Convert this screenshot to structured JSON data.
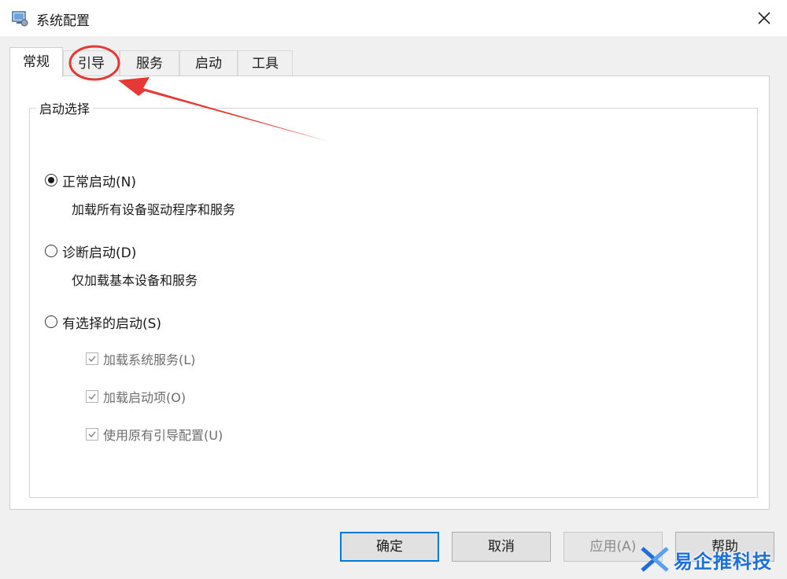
{
  "window": {
    "title": "系统配置",
    "icon": "msconfig-icon",
    "close_icon": "close-icon"
  },
  "tabs": [
    {
      "label": "常规",
      "active": true
    },
    {
      "label": "引导",
      "active": false
    },
    {
      "label": "服务",
      "active": false
    },
    {
      "label": "启动",
      "active": false
    },
    {
      "label": "工具",
      "active": false
    }
  ],
  "startup_selection": {
    "group_label": "启动选择",
    "options": [
      {
        "label": "正常启动(N)",
        "description": "加载所有设备驱动程序和服务",
        "selected": true
      },
      {
        "label": "诊断启动(D)",
        "description": "仅加载基本设备和服务",
        "selected": false
      },
      {
        "label": "有选择的启动(S)",
        "selected": false
      }
    ],
    "checkboxes": [
      {
        "label": "加载系统服务(L)",
        "checked": true,
        "disabled": true
      },
      {
        "label": "加载启动项(O)",
        "checked": true,
        "disabled": true
      },
      {
        "label": "使用原有引导配置(U)",
        "checked": true,
        "disabled": true
      }
    ]
  },
  "buttons": {
    "ok": "确定",
    "cancel": "取消",
    "apply": "应用(A)",
    "help": "帮助"
  },
  "annotation": {
    "color": "#e53935",
    "target": "引导"
  },
  "watermark": {
    "text": "易企推科技",
    "color": "#1e6fd9"
  }
}
